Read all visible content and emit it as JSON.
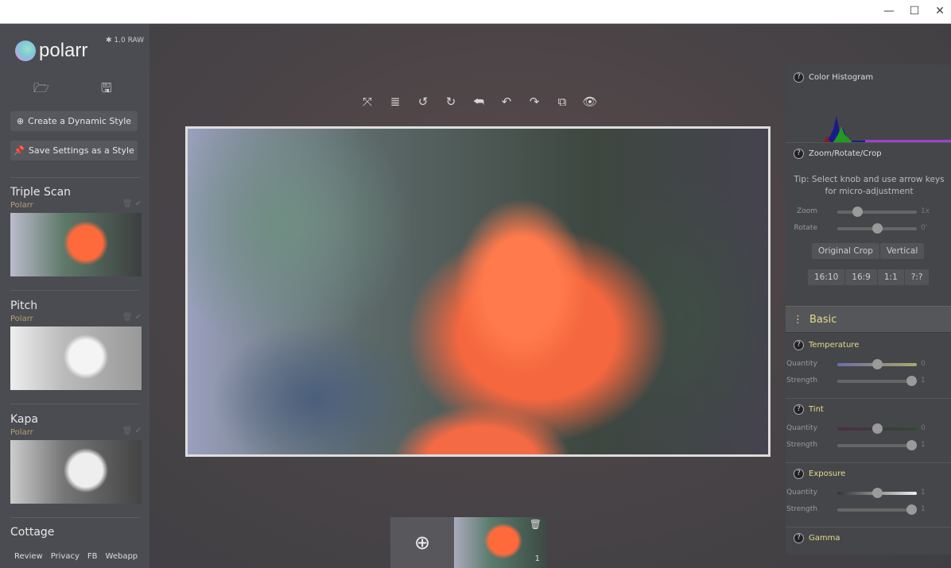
{
  "window": {
    "minimize": "—",
    "maximize": "☐",
    "close": "✕"
  },
  "sidebar": {
    "logo_text": "polarr",
    "version": "1.0 RAW",
    "open_icon": "folder-open-icon",
    "save_icon": "save-icon",
    "create_style": "Create a Dynamic Style",
    "save_style": "Save Settings as a Style",
    "styles": [
      {
        "name": "Triple Scan",
        "author": "Polarr"
      },
      {
        "name": "Pitch",
        "author": "Polarr"
      },
      {
        "name": "Kapa",
        "author": "Polarr"
      },
      {
        "name": "Cottage"
      }
    ],
    "footer": [
      "Review",
      "Privacy",
      "FB",
      "Webapp"
    ]
  },
  "toolbar": [
    "fullscreen-icon",
    "align-icon",
    "rotate-left-icon",
    "rotate-right-icon",
    "undo-all-icon",
    "undo-icon",
    "redo-icon",
    "compare-icon",
    "preview-eye-icon"
  ],
  "filmstrip": {
    "count": "1"
  },
  "panel": {
    "histogram": {
      "title": "Color Histogram"
    },
    "crop": {
      "title": "Zoom/Rotate/Crop",
      "tip": "Tip: Select knob and use arrow keys for micro-adjustment",
      "zoom": {
        "label": "Zoom",
        "value": "1x",
        "position": 0.25
      },
      "rotate": {
        "label": "Rotate",
        "value": "0'",
        "position": 0.5
      },
      "buttons": [
        "Original Crop",
        "Vertical"
      ],
      "ratios": [
        "16:10",
        "16:9",
        "1:1",
        "?:?"
      ]
    },
    "basic": {
      "title": "Basic"
    },
    "groups": [
      {
        "title": "Temperature",
        "quantity": {
          "label": "Quantity",
          "value": "0",
          "position": 0.5
        },
        "strength": {
          "label": "Strength",
          "value": "1",
          "position": 0.93
        },
        "gradient": [
          "#6c6ca8",
          "#a9a865"
        ]
      },
      {
        "title": "Tint",
        "quantity": {
          "label": "Quantity",
          "value": "0",
          "position": 0.5
        },
        "strength": {
          "label": "Strength",
          "value": "1",
          "position": 0.93
        },
        "gradient": [
          "#4a2f47",
          "#2f4a33"
        ]
      },
      {
        "title": "Exposure",
        "quantity": {
          "label": "Quantity",
          "value": "1",
          "position": 0.5
        },
        "strength": {
          "label": "Strength",
          "value": "1",
          "position": 0.93
        },
        "gradient": [
          "#333",
          "#eee"
        ]
      },
      {
        "title": "Gamma"
      }
    ]
  },
  "colors": {
    "accent": "#e3dc8a",
    "author": "#b3a070"
  }
}
